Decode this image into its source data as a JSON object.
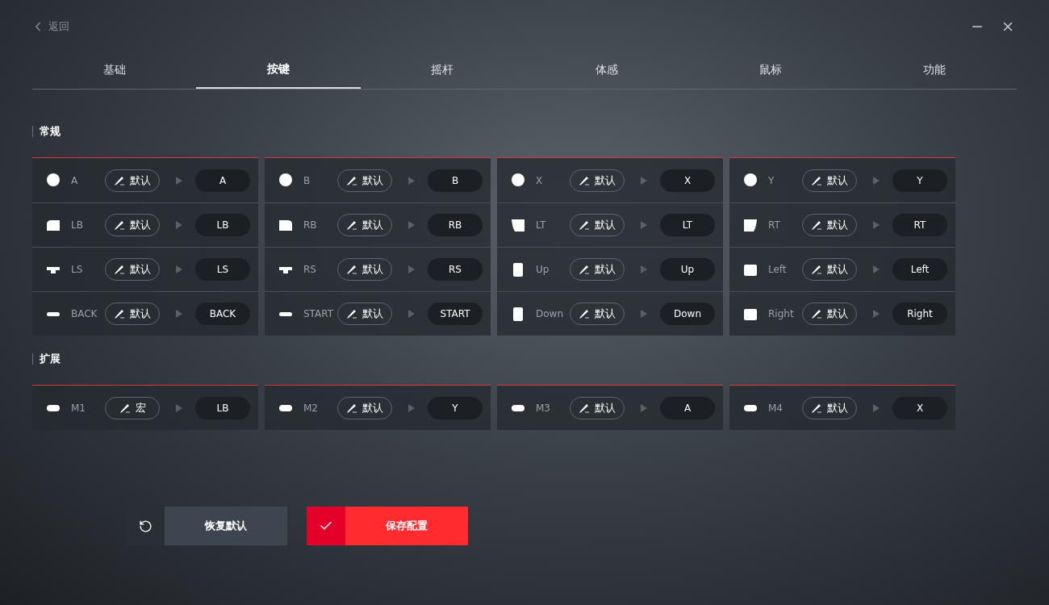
{
  "back": {
    "label": "返回"
  },
  "tabs": [
    {
      "label": "基础",
      "selected": false
    },
    {
      "label": "按键",
      "selected": true
    },
    {
      "label": "摇杆",
      "selected": false
    },
    {
      "label": "体感",
      "selected": false
    },
    {
      "label": "鼠标",
      "selected": false
    },
    {
      "label": "功能",
      "selected": false
    }
  ],
  "sections": [
    {
      "title": "常规",
      "cards": [
        {
          "rows": [
            {
              "kind": "face",
              "key": "A",
              "mode": "默认",
              "target": "A"
            },
            {
              "kind": "bumper_left",
              "key": "LB",
              "mode": "默认",
              "target": "LB"
            },
            {
              "kind": "stick",
              "key": "LS",
              "mode": "默认",
              "target": "LS"
            },
            {
              "kind": "menu",
              "key": "BACK",
              "mode": "默认",
              "target": "BACK"
            }
          ]
        },
        {
          "rows": [
            {
              "kind": "face",
              "key": "B",
              "mode": "默认",
              "target": "B"
            },
            {
              "kind": "bumper_right",
              "key": "RB",
              "mode": "默认",
              "target": "RB"
            },
            {
              "kind": "stick",
              "key": "RS",
              "mode": "默认",
              "target": "RS"
            },
            {
              "kind": "menu",
              "key": "START",
              "mode": "默认",
              "target": "START"
            }
          ]
        },
        {
          "rows": [
            {
              "kind": "face",
              "key": "X",
              "mode": "默认",
              "target": "X"
            },
            {
              "kind": "trigger_left",
              "key": "LT",
              "mode": "默认",
              "target": "LT"
            },
            {
              "kind": "dpad_vertical",
              "key": "Up",
              "mode": "默认",
              "target": "Up"
            },
            {
              "kind": "dpad_vertical",
              "key": "Down",
              "mode": "默认",
              "target": "Down"
            }
          ]
        },
        {
          "rows": [
            {
              "kind": "face",
              "key": "Y",
              "mode": "默认",
              "target": "Y"
            },
            {
              "kind": "trigger_right",
              "key": "RT",
              "mode": "默认",
              "target": "RT"
            },
            {
              "kind": "dpad_horizontal",
              "key": "Left",
              "mode": "默认",
              "target": "Left"
            },
            {
              "kind": "dpad_horizontal",
              "key": "Right",
              "mode": "默认",
              "target": "Right"
            }
          ]
        }
      ]
    },
    {
      "title": "扩展",
      "cards": [
        {
          "rows": [
            {
              "kind": "paddle",
              "key": "M1",
              "mode": "宏",
              "target": "LB"
            }
          ]
        },
        {
          "rows": [
            {
              "kind": "paddle",
              "key": "M2",
              "mode": "默认",
              "target": "Y"
            }
          ]
        },
        {
          "rows": [
            {
              "kind": "paddle",
              "key": "M3",
              "mode": "默认",
              "target": "A"
            }
          ]
        },
        {
          "rows": [
            {
              "kind": "paddle",
              "key": "M4",
              "mode": "默认",
              "target": "X"
            }
          ]
        }
      ]
    }
  ],
  "buttons": [
    {
      "kind": "reset",
      "label": "恢复默认"
    },
    {
      "kind": "save",
      "label": "保存配置"
    }
  ]
}
